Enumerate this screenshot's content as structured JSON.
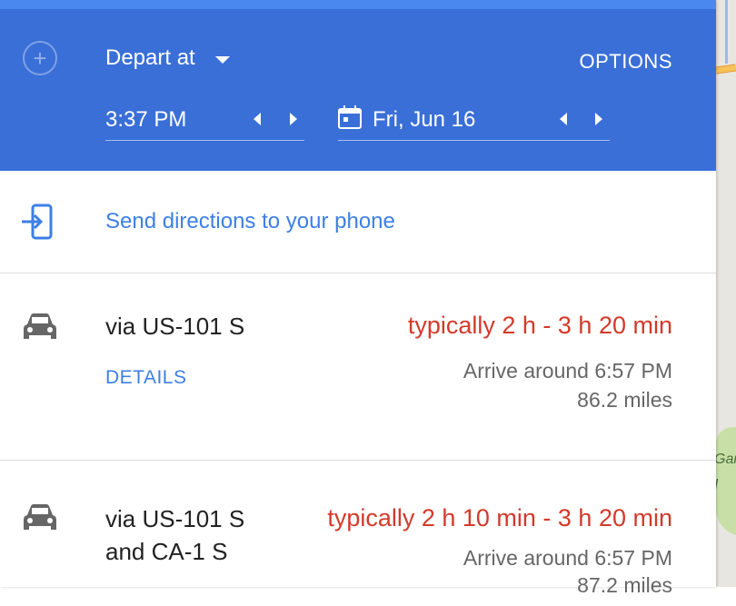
{
  "header": {
    "depart_label": "Depart at",
    "options_label": "OPTIONS",
    "time_value": "3:37 PM",
    "date_value": "Fri, Jun 16"
  },
  "send": {
    "label": "Send directions to your phone"
  },
  "routes": [
    {
      "via": "via US-101 S",
      "duration": "typically 2 h - 3 h 20 min",
      "details_label": "DETAILS",
      "arrive": "Arrive around 6:57 PM",
      "distance": "86.2 miles"
    },
    {
      "via": "via US-101 S and CA-1 S",
      "duration": "typically 2 h 10 min - 3 h 20 min",
      "arrive": "Arrive around 6:57 PM",
      "distance": "87.2 miles"
    }
  ],
  "map": {
    "park_label": "Gar\nI"
  },
  "colors": {
    "header_bg": "#3a6fd8",
    "link": "#3d7fe6",
    "traffic_red": "#d23a2a"
  }
}
